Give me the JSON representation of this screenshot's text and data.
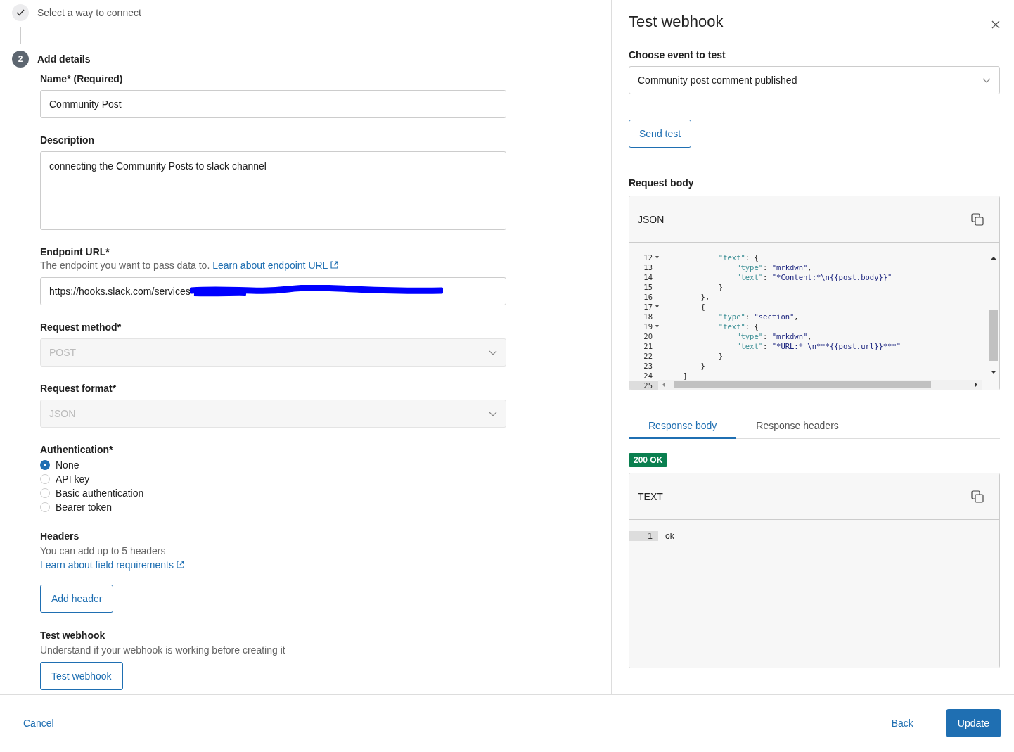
{
  "steps": [
    {
      "label": "Select a way to connect",
      "kind": "done"
    },
    {
      "number": "2",
      "label": "Add details",
      "kind": "current"
    }
  ],
  "form": {
    "name": {
      "label": "Name* (Required)",
      "value": "Community Post"
    },
    "description": {
      "label": "Description",
      "value": "connecting the Community Posts to slack channel"
    },
    "endpoint": {
      "label": "Endpoint URL*",
      "help": "The endpoint you want to pass data to.",
      "link": "Learn about endpoint URL",
      "value": "https://hooks.slack.com/services",
      "redacted": true
    },
    "selects": [
      {
        "label": "Request method*",
        "value": "POST",
        "disabled": true
      },
      {
        "label": "Request format*",
        "value": "JSON",
        "disabled": true
      }
    ],
    "authentication": {
      "label": "Authentication*",
      "options": [
        {
          "label": "None",
          "selected": true
        },
        {
          "label": "API key",
          "selected": false
        },
        {
          "label": "Basic authentication",
          "selected": false
        },
        {
          "label": "Bearer token",
          "selected": false
        }
      ]
    },
    "headers": {
      "title": "Headers",
      "help": "You can add up to 5 headers",
      "link": "Learn about field requirements",
      "button": "Add header"
    },
    "test": {
      "title": "Test webhook",
      "help": "Understand if your webhook is working before creating it",
      "button": "Test webhook"
    }
  },
  "panel": {
    "title": "Test webhook",
    "event": {
      "label": "Choose event to test",
      "value": "Community post comment published"
    },
    "send_button": "Send test",
    "request": {
      "label": "Request body",
      "format": "JSON",
      "lines": [
        {
          "number": "12",
          "foldable": true,
          "active": false,
          "code": "            \"text\": {"
        },
        {
          "number": "13",
          "foldable": false,
          "active": false,
          "code": "                \"type\": \"mrkdwn\","
        },
        {
          "number": "14",
          "foldable": false,
          "active": false,
          "code": "                \"text\": \"*Content:*\\n{{post.body}}\""
        },
        {
          "number": "15",
          "foldable": false,
          "active": false,
          "code": "            }"
        },
        {
          "number": "16",
          "foldable": false,
          "active": false,
          "code": "        },"
        },
        {
          "number": "17",
          "foldable": true,
          "active": false,
          "code": "        {"
        },
        {
          "number": "18",
          "foldable": false,
          "active": false,
          "code": "            \"type\": \"section\","
        },
        {
          "number": "19",
          "foldable": true,
          "active": false,
          "code": "            \"text\": {"
        },
        {
          "number": "20",
          "foldable": false,
          "active": false,
          "code": "                \"type\": \"mrkdwn\","
        },
        {
          "number": "21",
          "foldable": false,
          "active": false,
          "code": "                \"text\": \"*URL:* \\n***{{post.url}}***\""
        },
        {
          "number": "22",
          "foldable": false,
          "active": false,
          "code": "            }"
        },
        {
          "number": "23",
          "foldable": false,
          "active": false,
          "code": "        }"
        },
        {
          "number": "24",
          "foldable": false,
          "active": false,
          "code": "    ]"
        },
        {
          "number": "25",
          "foldable": false,
          "active": true
        }
      ]
    },
    "tabs": [
      {
        "label": "Response body",
        "selected": true
      },
      {
        "label": "Response headers",
        "selected": false
      }
    ],
    "status": "200 OK",
    "response": {
      "format": "TEXT",
      "lines": [
        {
          "number": "1",
          "active": true,
          "code": "ok"
        }
      ]
    }
  },
  "footer": {
    "cancel": "Cancel",
    "back": "Back",
    "update": "Update"
  }
}
